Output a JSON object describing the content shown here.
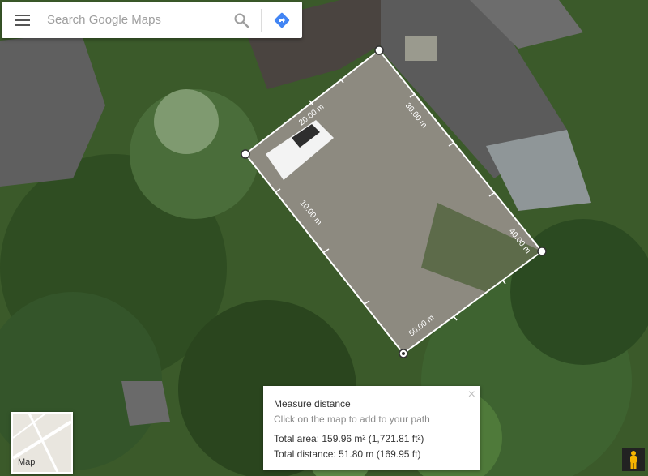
{
  "search": {
    "placeholder": "Search Google Maps"
  },
  "measure": {
    "labels": [
      "20.00 m",
      "30.00 m",
      "10.00 m",
      "40.00 m",
      "50.00 m"
    ],
    "card": {
      "title": "Measure distance",
      "hint": "Click on the map to add to your path",
      "total_area": "Total area: 159.96 m² (1,721.81 ft²)",
      "total_distance": "Total distance: 51.80 m (169.95 ft)",
      "close": "×"
    }
  },
  "minimap": {
    "label": "Map"
  },
  "icons": {
    "menu": "menu-icon",
    "search": "search-icon",
    "directions": "directions-icon",
    "close": "close-icon",
    "pegman": "pegman-icon"
  },
  "colors": {
    "directions_blue": "#4285f4",
    "pegman_yellow": "#f5b400"
  }
}
